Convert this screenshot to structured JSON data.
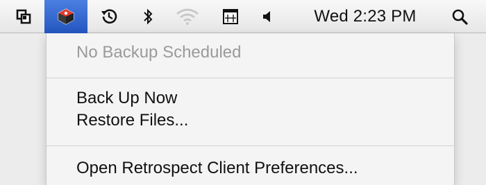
{
  "menubar": {
    "icons": [
      {
        "name": "screen-sharing-icon"
      },
      {
        "name": "retrospect-icon",
        "active": true
      },
      {
        "name": "time-machine-icon"
      },
      {
        "name": "bluetooth-icon"
      },
      {
        "name": "wifi-icon"
      },
      {
        "name": "input-menu-icon"
      },
      {
        "name": "volume-icon"
      }
    ],
    "clock": "Wed 2:23 PM",
    "spotlight_icon": "search-icon"
  },
  "menu": {
    "status": "No Backup Scheduled",
    "back_up_now": "Back Up Now",
    "restore_files": "Restore Files...",
    "open_preferences": "Open Retrospect Client Preferences..."
  },
  "colors": {
    "highlight": "#2f62c9",
    "disabled_text": "#9a9a9a"
  }
}
